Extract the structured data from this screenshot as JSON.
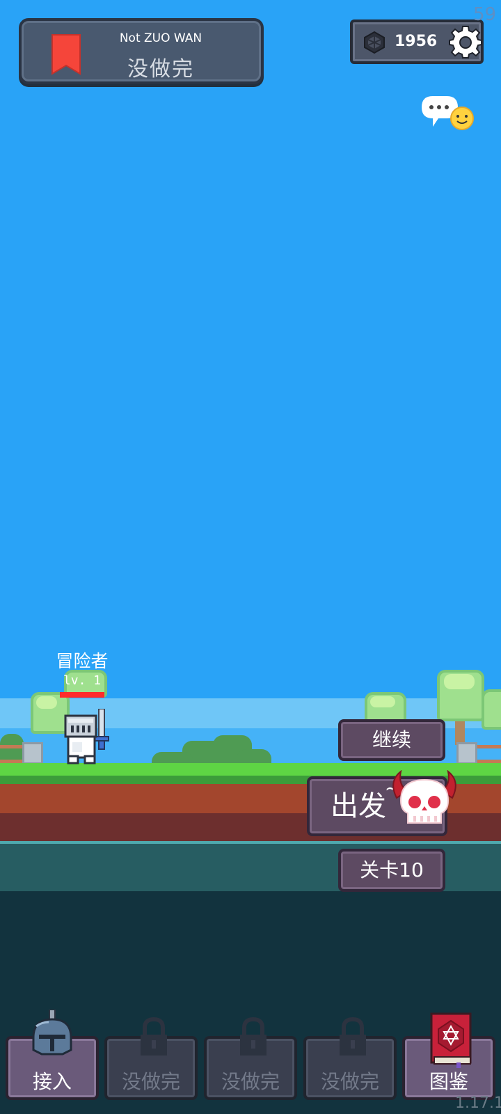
{
  "header": {
    "title_en": "Not ZUO WAN",
    "title_cn": "没做完",
    "bookmark_icon": "bookmark-icon",
    "gem_count": "1956",
    "gem_icon": "gem-icon",
    "settings_icon": "gear-icon",
    "fps": "59"
  },
  "chat": {
    "icon": "chat-bubble-icon"
  },
  "hero": {
    "name": "冒险者",
    "level": "lv. 1",
    "hp_fraction": 1.0
  },
  "actions": {
    "continue_label": "继续",
    "go_label": "出发",
    "go_suffix": "~",
    "stage_label": "关卡10",
    "boss_icon": "skull-icon"
  },
  "tabs": [
    {
      "label": "接入",
      "icon": "helmet-icon",
      "active": true
    },
    {
      "label": "没做完",
      "icon": "lock-icon",
      "active": false
    },
    {
      "label": "没做完",
      "icon": "lock-icon",
      "active": false
    },
    {
      "label": "没做完",
      "icon": "lock-icon",
      "active": false
    },
    {
      "label": "图鉴",
      "icon": "spellbook-icon",
      "active": true
    }
  ],
  "version": "1.17.1",
  "colors": {
    "sky": "#29a3f7",
    "button_purple": "#5d4a62",
    "hp_red": "#ff2b2b",
    "grass": "#5ed544"
  }
}
